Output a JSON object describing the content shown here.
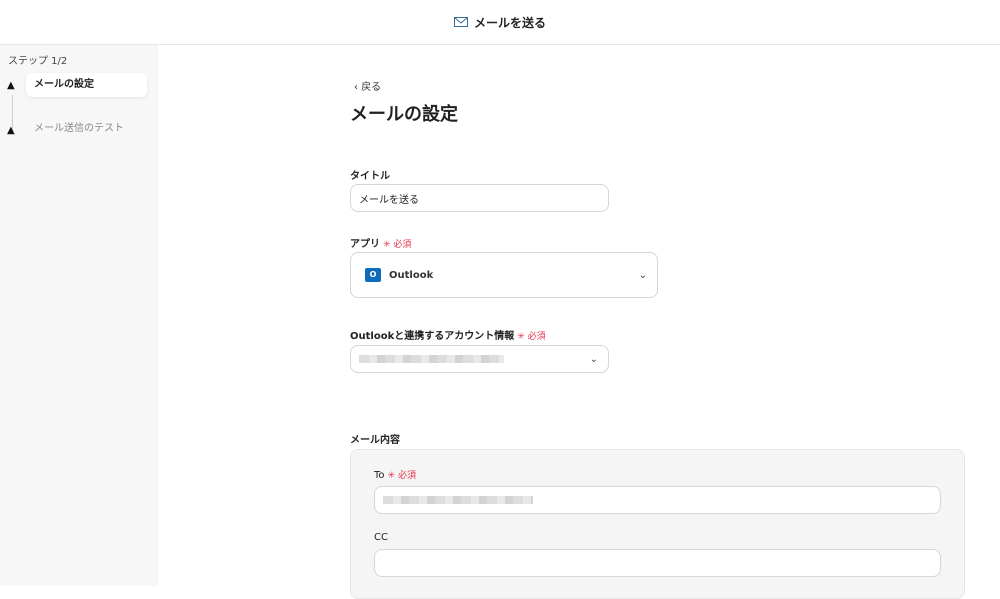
{
  "header": {
    "title": "メールを送る",
    "icon": "mail-icon"
  },
  "sidebar": {
    "step_counter": "ステップ 1/2",
    "steps": [
      {
        "label": "メールの設定",
        "state": "active",
        "icon": "warning-icon"
      },
      {
        "label": "メール送信のテスト",
        "state": "inactive",
        "icon": "warning-icon"
      }
    ]
  },
  "main": {
    "back": "戻る",
    "page_title": "メールの設定",
    "title_field": {
      "label": "タイトル",
      "value": "メールを送る"
    },
    "app_field": {
      "label": "アプリ",
      "required": "必須",
      "value": "Outlook"
    },
    "account_field": {
      "label": "Outlookと連携するアカウント情報",
      "required": "必須"
    },
    "mail_content": {
      "label": "メール内容",
      "to": {
        "label": "To",
        "required": "必須"
      },
      "cc": {
        "label": "CC"
      }
    }
  },
  "colors": {
    "required": "#e5334b",
    "outlook": "#0f6cbd"
  }
}
